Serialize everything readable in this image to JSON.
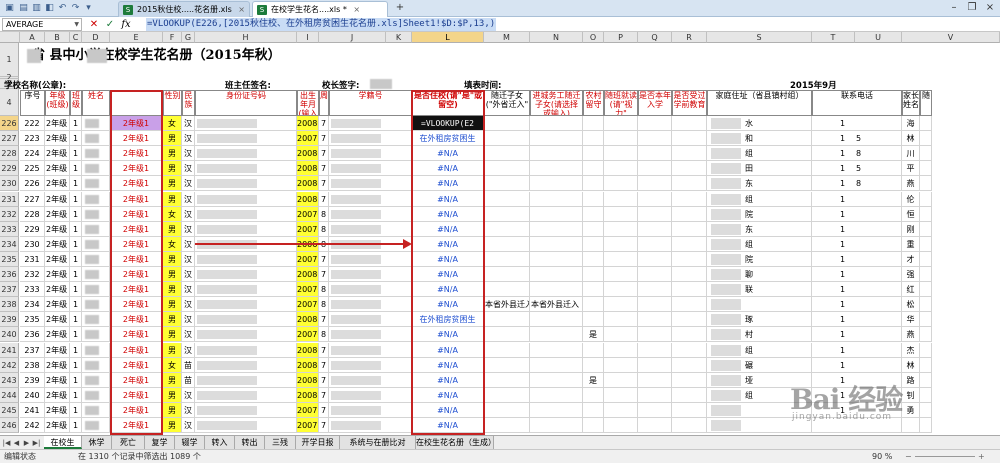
{
  "window": {
    "tabs": [
      {
        "label": "2015秋住校.....花名册.xls",
        "active": false
      },
      {
        "label": "在校学生花名....xls *",
        "active": true
      }
    ]
  },
  "formula_bar": {
    "name_box": "AVERAGE",
    "formula": "=VLOOKUP(E226,[2015秋住校、在外租房贫困生花名册.xls]Sheet1!$D:$P,13,)"
  },
  "columns": [
    "A",
    "B",
    "C",
    "D",
    "E",
    "F",
    "G",
    "H",
    "I",
    "J",
    "K",
    "L",
    "M",
    "N",
    "O",
    "P",
    "Q",
    "R",
    "S",
    "T",
    "U",
    "V"
  ],
  "sheet": {
    "title": "省 县中小学在校学生花名册（2015年秋）",
    "school_label": "学校名称(公章):",
    "teacher_label": "班主任签名:",
    "principal_label": "校长签字:",
    "fill_time_label": "填表时间:",
    "year_month": "2015年9月"
  },
  "headers": {
    "seq": "序号",
    "grade": "年级(班级)",
    "class": "班级",
    "name": "姓名",
    "gender": "性别",
    "ethnic": "民族",
    "id_number": "身份证号码",
    "birth": "出生年月(输入纯数字)",
    "week": "周",
    "student_no": "学籍号",
    "boarding": "是否住校(请\"是\"或留空)",
    "migrant": "随迁子女(\"外省迁入\"",
    "city_migrant": "进城务工随迁子女(请选择或输入)",
    "rural": "农村留守",
    "disabled": "随班就读(请\"视力\"",
    "only_child": "是否本年入学",
    "preschool": "是否受过学前教育",
    "address": "家庭住址（省县镇村组）",
    "phone": "联系电话",
    "guardian": "家长姓名",
    "extra": "随"
  },
  "rows": [
    {
      "row": "226",
      "seq": "222",
      "grade": "2年级",
      "class": "1",
      "e": "2年级1",
      "gender": "女",
      "ethnic": "汉",
      "birth": "20080401",
      "week": "7",
      "boarding": "=VLOOKUP(E2",
      "addr": "水",
      "phone": "1",
      "phone2": "",
      "guardian": "海",
      "special": "formula"
    },
    {
      "row": "227",
      "seq": "223",
      "grade": "2年级",
      "class": "1",
      "e": "2年级1",
      "gender": "男",
      "ethnic": "汉",
      "birth": "20071226",
      "week": "7",
      "boarding": "在外租房贫困生",
      "addr": "和",
      "phone": "1",
      "phone2": "5",
      "guardian": "林"
    },
    {
      "row": "228",
      "seq": "224",
      "grade": "2年级",
      "class": "1",
      "e": "2年级1",
      "gender": "男",
      "ethnic": "汉",
      "birth": "20080608",
      "week": "7",
      "boarding": "#N/A",
      "addr": "组",
      "phone": "1",
      "phone2": "8",
      "guardian": "川"
    },
    {
      "row": "229",
      "seq": "225",
      "grade": "2年级",
      "class": "1",
      "e": "2年级1",
      "gender": "男",
      "ethnic": "汉",
      "birth": "20080217",
      "week": "7",
      "boarding": "#N/A",
      "addr": "田",
      "phone": "1",
      "phone2": "5",
      "guardian": "平"
    },
    {
      "row": "230",
      "seq": "226",
      "grade": "2年级",
      "class": "1",
      "e": "2年级1",
      "gender": "男",
      "ethnic": "汉",
      "birth": "20080426",
      "week": "7",
      "boarding": "#N/A",
      "addr": "东",
      "phone": "1",
      "phone2": "8",
      "guardian": "燕"
    },
    {
      "row": "231",
      "seq": "227",
      "grade": "2年级",
      "class": "1",
      "e": "2年级1",
      "gender": "男",
      "ethnic": "汉",
      "birth": "20080315",
      "week": "7",
      "boarding": "#N/A",
      "addr": "组",
      "phone": "1",
      "phone2": "",
      "guardian": "伦"
    },
    {
      "row": "232",
      "seq": "228",
      "grade": "2年级",
      "class": "1",
      "e": "2年级1",
      "gender": "女",
      "ethnic": "汉",
      "birth": "20070712",
      "week": "8",
      "boarding": "#N/A",
      "addr": "院",
      "phone": "1",
      "phone2": "",
      "guardian": "恒"
    },
    {
      "row": "233",
      "seq": "229",
      "grade": "2年级",
      "class": "1",
      "e": "2年级1",
      "gender": "男",
      "ethnic": "汉",
      "birth": "20070719",
      "week": "8",
      "boarding": "#N/A",
      "addr": "东",
      "phone": "1",
      "phone2": "",
      "guardian": "刚"
    },
    {
      "row": "234",
      "seq": "230",
      "grade": "2年级",
      "class": "1",
      "e": "2年级1",
      "gender": "女",
      "ethnic": "汉",
      "birth": "20061212",
      "week": "8",
      "boarding": "#N/A",
      "addr": "组",
      "phone": "1",
      "phone2": "",
      "guardian": "重"
    },
    {
      "row": "235",
      "seq": "231",
      "grade": "2年级",
      "class": "1",
      "e": "2年级1",
      "gender": "男",
      "ethnic": "汉",
      "birth": "20071218",
      "week": "7",
      "boarding": "#N/A",
      "addr": "院",
      "phone": "1",
      "phone2": "",
      "guardian": "才"
    },
    {
      "row": "236",
      "seq": "232",
      "grade": "2年级",
      "class": "1",
      "e": "2年级1",
      "gender": "男",
      "ethnic": "汉",
      "birth": "20080830",
      "week": "7",
      "boarding": "#N/A",
      "addr": "聊",
      "phone": "1",
      "phone2": "",
      "guardian": "强"
    },
    {
      "row": "237",
      "seq": "233",
      "grade": "2年级",
      "class": "1",
      "e": "2年级1",
      "gender": "男",
      "ethnic": "汉",
      "birth": "20070721",
      "week": "8",
      "boarding": "#N/A",
      "addr": "联",
      "phone": "1",
      "phone2": "",
      "guardian": "红"
    },
    {
      "row": "238",
      "seq": "234",
      "grade": "2年级",
      "class": "1",
      "e": "2年级1",
      "gender": "男",
      "ethnic": "汉",
      "birth": "20070328",
      "week": "8",
      "boarding": "#N/A",
      "migrant": "本省外县迁入",
      "city_migrant": "本省外县迁入",
      "addr": "",
      "phone": "1",
      "phone2": "",
      "guardian": "松"
    },
    {
      "row": "239",
      "seq": "235",
      "grade": "2年级",
      "class": "1",
      "e": "2年级1",
      "gender": "男",
      "ethnic": "汉",
      "birth": "20080107",
      "week": "7",
      "boarding": "在外租房贫困生",
      "addr": "琢",
      "phone": "1",
      "phone2": "",
      "guardian": "华"
    },
    {
      "row": "240",
      "seq": "236",
      "grade": "2年级",
      "class": "1",
      "e": "2年级1",
      "gender": "男",
      "ethnic": "汉",
      "birth": "20070624",
      "week": "8",
      "boarding": "#N/A",
      "rural": "是",
      "addr": "村",
      "phone": "1",
      "phone2": "",
      "guardian": "燕"
    },
    {
      "row": "241",
      "seq": "237",
      "grade": "2年级",
      "class": "1",
      "e": "2年级1",
      "gender": "男",
      "ethnic": "汉",
      "birth": "20080220",
      "week": "7",
      "boarding": "#N/A",
      "addr": "组",
      "phone": "1",
      "phone2": "",
      "guardian": "杰"
    },
    {
      "row": "242",
      "seq": "238",
      "grade": "2年级",
      "class": "1",
      "e": "2年级1",
      "gender": "女",
      "ethnic": "苗",
      "birth": "20080531",
      "week": "7",
      "boarding": "#N/A",
      "addr": "碾",
      "phone": "1",
      "phone2": "",
      "guardian": "林"
    },
    {
      "row": "243",
      "seq": "239",
      "grade": "2年级",
      "class": "1",
      "e": "2年级1",
      "gender": "男",
      "ethnic": "苗",
      "birth": "20080611",
      "week": "7",
      "boarding": "#N/A",
      "rural": "是",
      "addr": "垭",
      "phone": "1",
      "phone2": "",
      "guardian": "路"
    },
    {
      "row": "244",
      "seq": "240",
      "grade": "2年级",
      "class": "1",
      "e": "2年级1",
      "gender": "男",
      "ethnic": "汉",
      "birth": "20080106",
      "week": "7",
      "boarding": "#N/A",
      "addr": "组",
      "phone": "1",
      "phone2": "",
      "guardian": "钊"
    },
    {
      "row": "245",
      "seq": "241",
      "grade": "2年级",
      "class": "1",
      "e": "2年级1",
      "gender": "男",
      "ethnic": "汉",
      "birth": "20071217",
      "week": "7",
      "boarding": "#N/A",
      "addr": "",
      "phone": "1",
      "phone2": "",
      "guardian": "勇"
    },
    {
      "row": "246",
      "seq": "242",
      "grade": "2年级",
      "class": "1",
      "e": "2年级1",
      "gender": "男",
      "ethnic": "汉",
      "birth": "20071224",
      "week": "7",
      "boarding": "#N/A",
      "addr": "",
      "phone": "",
      "phone2": "",
      "guardian": ""
    }
  ],
  "sheet_tabs": [
    "在校生",
    "休学",
    "死亡",
    "复学",
    "辍学",
    "转入",
    "转出",
    "三残",
    "开学日报",
    "系统与在册比对",
    "在校生花名册（生成）"
  ],
  "status": {
    "mode": "编辑状态",
    "filter_info": "在 1310 个记录中筛选出 1089 个",
    "zoom": "90 %"
  },
  "watermark": {
    "logo": "Bai 经验",
    "url": "jingyan.baidu.com"
  }
}
